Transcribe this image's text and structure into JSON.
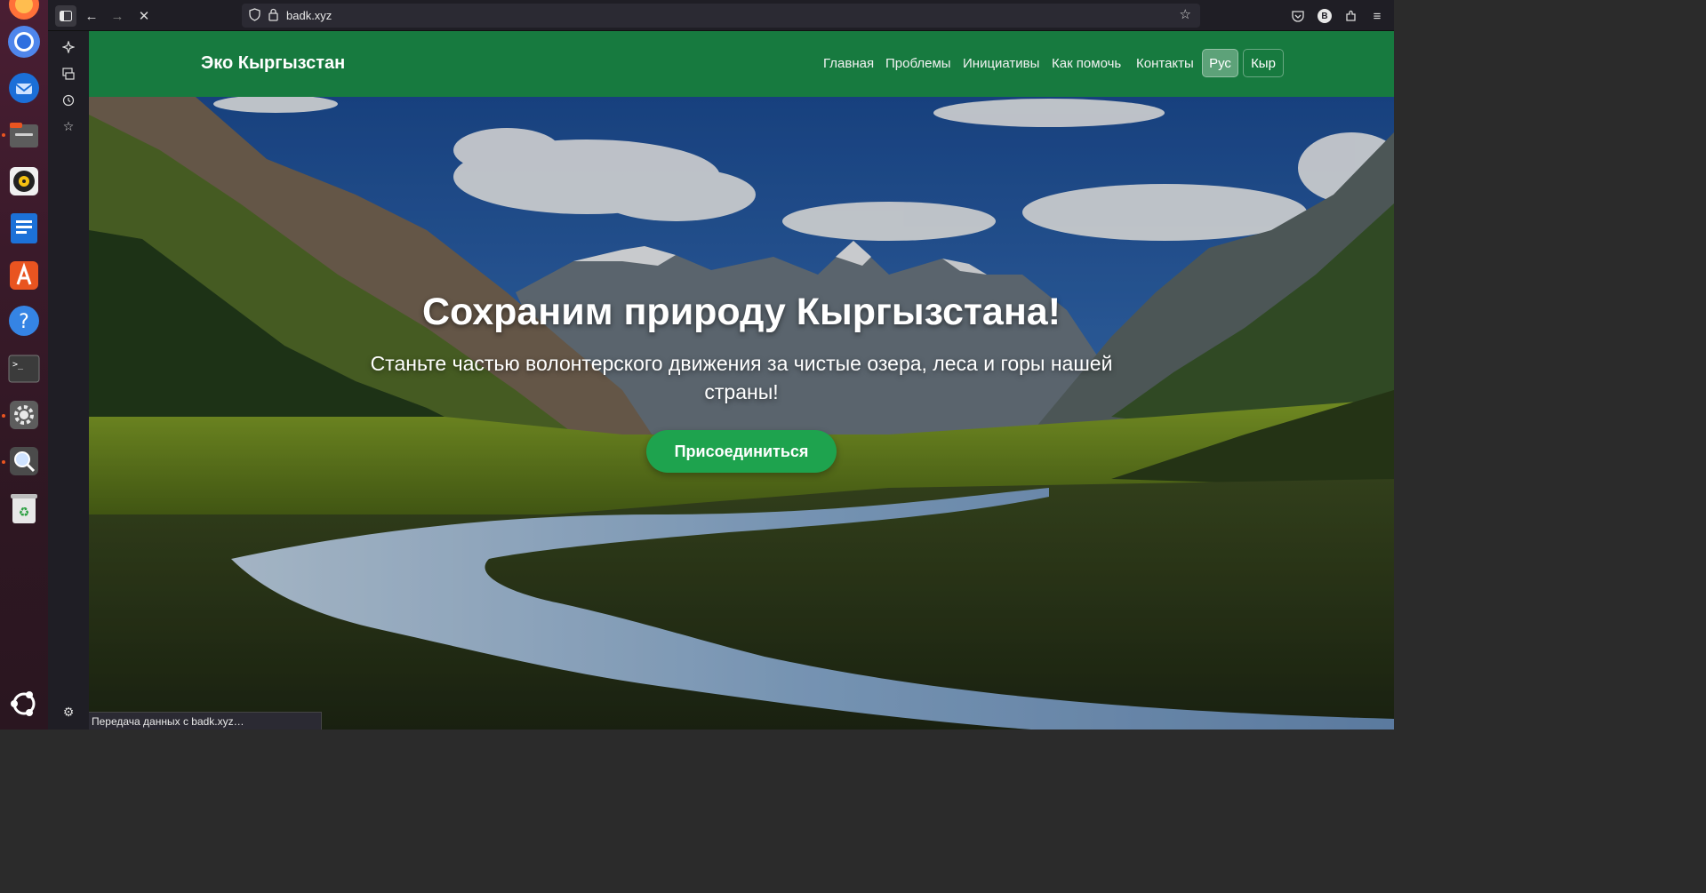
{
  "browser": {
    "url": "badk.xyz",
    "status_text": "Передача данных с badk.xyz…",
    "account_initial": "B"
  },
  "site": {
    "brand": "Эко Кыргызстан",
    "nav": [
      "Главная",
      "Проблемы",
      "Инициативы",
      "Как помочь",
      "Контакты"
    ],
    "lang_ru": "Рус",
    "lang_ky": "Кыр"
  },
  "hero": {
    "title": "Сохраним природу Кыргызстана!",
    "subtitle": "Станьте частью волонтерского движения за чистые озера, леса и горы нашей страны!",
    "cta": "Присоединиться"
  },
  "colors": {
    "navbar": "#177a3f",
    "cta": "#1ea34e",
    "ubuntu_accent": "#e95420"
  },
  "icons": {
    "dock": [
      "firefox-icon",
      "chrome-icon",
      "thunderbird-icon",
      "files-icon",
      "rhythmbox-icon",
      "writer-icon",
      "app-center-icon",
      "help-icon",
      "terminal-icon",
      "settings-icon",
      "magnifier-icon",
      "trash-icon",
      "ubuntu-logo-icon"
    ]
  }
}
